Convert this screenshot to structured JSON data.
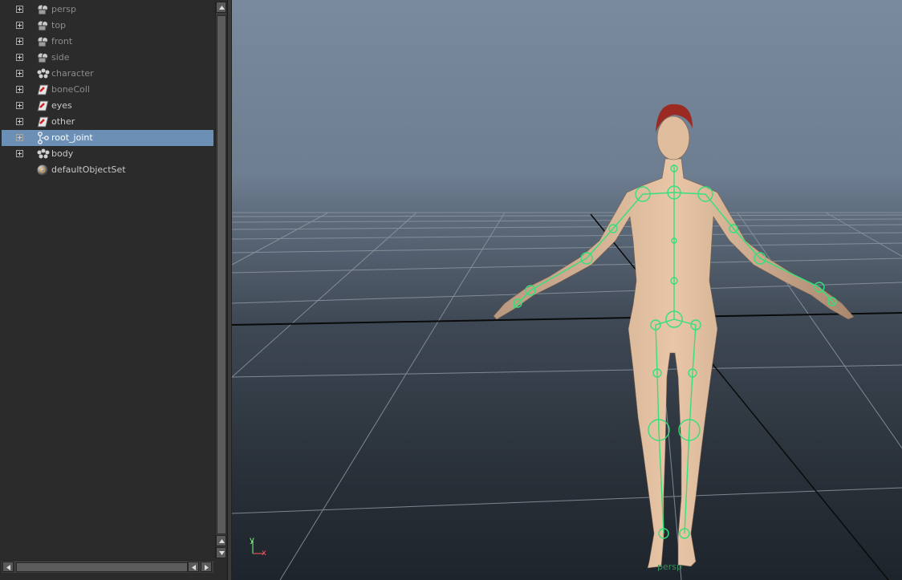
{
  "outliner": {
    "items": [
      {
        "label": "persp",
        "icon": "camera-icon",
        "dim": true
      },
      {
        "label": "top",
        "icon": "camera-icon",
        "dim": true
      },
      {
        "label": "front",
        "icon": "camera-icon",
        "dim": true
      },
      {
        "label": "side",
        "icon": "camera-icon",
        "dim": true
      },
      {
        "label": "character",
        "icon": "character-set-icon",
        "dim": true
      },
      {
        "label": "boneColl",
        "icon": "display-layer-icon",
        "dim": true
      },
      {
        "label": "eyes",
        "icon": "display-layer-icon",
        "dim": false
      },
      {
        "label": "other",
        "icon": "display-layer-icon",
        "dim": false
      },
      {
        "label": "root_joint",
        "icon": "joint-icon",
        "dim": false,
        "selected": true
      },
      {
        "label": "body",
        "icon": "character-set-icon",
        "dim": false
      },
      {
        "label": "defaultObjectSet",
        "icon": "object-set-icon",
        "dim": false
      }
    ],
    "selection_color": "#6b8fb5"
  },
  "viewport": {
    "axis_y": "y",
    "axis_x": "x",
    "camera_label": "persp",
    "skeleton_color": "#34e07a",
    "grid_color": "#9aa3ad"
  }
}
